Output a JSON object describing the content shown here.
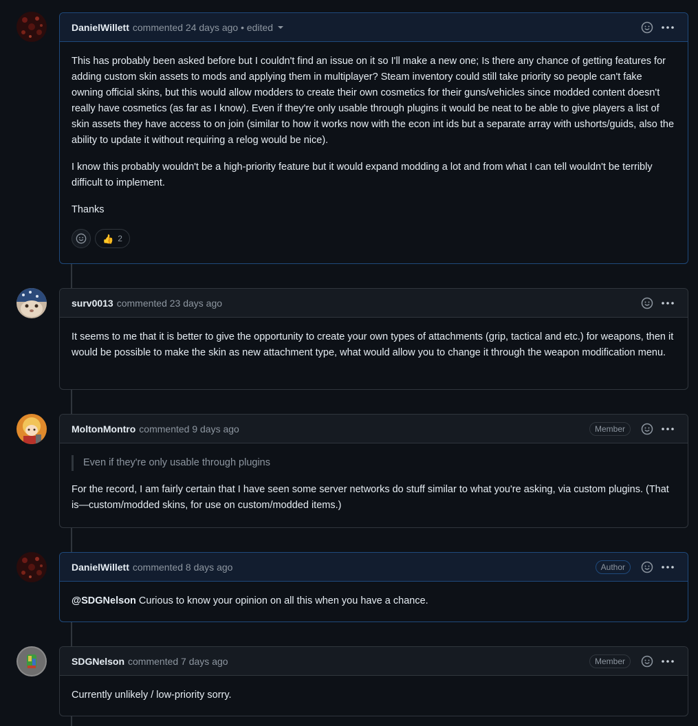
{
  "comments": [
    {
      "author": "DanielWillett",
      "meta": "commented 24 days ago • edited",
      "badge": "",
      "paragraphs": [
        "This has probably been asked before but I couldn't find an issue on it so I'll make a new one; Is there any chance of getting features for adding custom skin assets to mods and applying them in multiplayer? Steam inventory could still take priority so people can't fake owning official skins, but this would allow modders to create their own cosmetics for their guns/vehicles since modded content doesn't really have cosmetics (as far as I know). Even if they're only usable through plugins it would be neat to be able to give players a list of skin assets they have access to on join (similar to how it works now with the econ int ids but a separate array with ushorts/guids, also the ability to update it without requiring a relog would be nice).",
        "I know this probably wouldn't be a high-priority feature but it would expand modding a lot and from what I can tell wouldn't be terribly difficult to implement.",
        "Thanks"
      ],
      "reaction_emoji": "👍",
      "reaction_count": "2"
    },
    {
      "author": "surv0013",
      "meta": "commented 23 days ago",
      "badge": "",
      "paragraphs": [
        "It seems to me that it is better to give the opportunity to create your own types of attachments (grip, tactical and etc.) for weapons, then it would be possible to make the skin as new attachment type, what would allow you to change it through the weapon modification menu."
      ]
    },
    {
      "author": "MoltonMontro",
      "meta": "commented 9 days ago",
      "badge": "Member",
      "quote": "Even if they're only usable through plugins",
      "paragraphs": [
        "For the record, I am fairly certain that I have seen some server networks do stuff similar to what you're asking, via custom plugins. (That is—custom/modded skins, for use on custom/modded items.)"
      ]
    },
    {
      "author": "DanielWillett",
      "meta": "commented 8 days ago",
      "badge": "Author",
      "mention": "@SDGNelson",
      "paragraphs": [
        " Curious to know your opinion on all this when you have a chance."
      ]
    },
    {
      "author": "SDGNelson",
      "meta": "commented 7 days ago",
      "badge": "Member",
      "paragraphs": [
        "Currently unlikely / low-priority sorry."
      ]
    }
  ],
  "colors": {
    "background": "#0d1117",
    "header": "#161b22",
    "own_header": "#121d2f",
    "border": "#30363d",
    "own_border": "#1f4a7d",
    "muted": "#8d96a0"
  },
  "icons": {
    "reaction": "smiley-icon",
    "menu": "kebab-horizontal-icon"
  }
}
